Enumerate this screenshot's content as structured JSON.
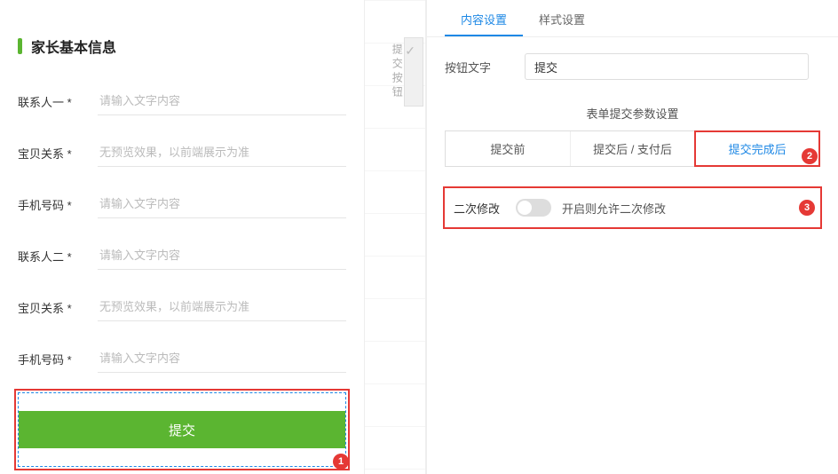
{
  "form": {
    "title": "家长基本信息",
    "rows": [
      {
        "label": "联系人一 *",
        "placeholder": "请输入文字内容"
      },
      {
        "label": "宝贝关系 *",
        "placeholder": "无预览效果，以前端展示为准"
      },
      {
        "label": "手机号码 *",
        "placeholder": "请输入文字内容"
      },
      {
        "label": "联系人二 *",
        "placeholder": "请输入文字内容"
      },
      {
        "label": "宝贝关系 *",
        "placeholder": "无预览效果，以前端展示为准"
      },
      {
        "label": "手机号码 *",
        "placeholder": "请输入文字内容"
      }
    ],
    "submit_label": "提交"
  },
  "side_tag": "提交按钮",
  "settings": {
    "top_tabs": {
      "content": "内容设置",
      "style": "样式设置"
    },
    "button_text": {
      "label": "按钮文字",
      "value": "提交"
    },
    "params_header": "表单提交参数设置",
    "sub_tabs": {
      "before": "提交前",
      "after_pay": "提交后 / 支付后",
      "complete": "提交完成后"
    },
    "edit_option": {
      "label": "二次修改",
      "hint": "开启则允许二次修改"
    }
  },
  "badges": {
    "one": "1",
    "two": "2",
    "three": "3"
  }
}
